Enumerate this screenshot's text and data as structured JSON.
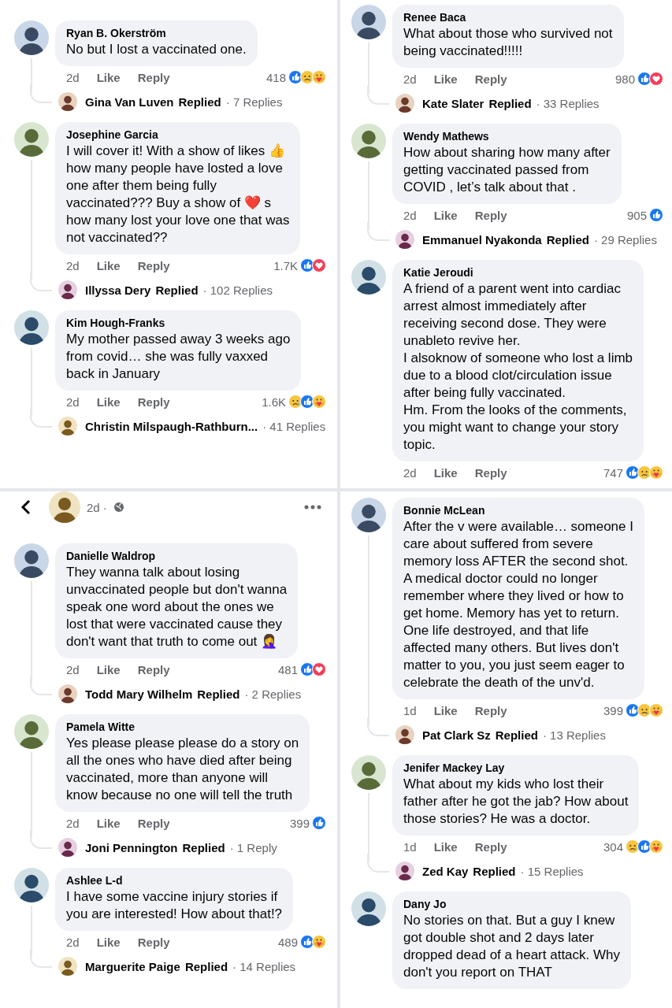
{
  "rows": [
    {
      "panels": [
        {
          "comments": [
            {
              "name": "Ryan B. Okerström",
              "text": "No but I lost a vaccinated one.",
              "time": "2d",
              "like": "Like",
              "reply": "Reply",
              "count": "418",
              "reactions": [
                {
                  "kind": "like"
                },
                {
                  "kind": "sad"
                },
                {
                  "kind": "care"
                }
              ],
              "thread": {
                "name": "Gina Van Luven",
                "label": "Replied",
                "replies": "· 7 Replies"
              }
            },
            {
              "name": "Josephine Garcia",
              "text": "I will cover it! With a show of likes 👍\nhow many people  have losted a love\none after them being fully\nvaccinated??? Buy a show  of  ❤️ s\nhow many lost your love one that was\nnot vaccinated??",
              "time": "2d",
              "like": "Like",
              "reply": "Reply",
              "count": "1.7K",
              "reactions": [
                {
                  "kind": "like"
                },
                {
                  "kind": "love"
                }
              ],
              "thread": {
                "name": "Illyssa Dery",
                "label": "Replied",
                "replies": "· 102 Replies"
              }
            },
            {
              "name": "Kim Hough-Franks",
              "text": "My mother passed away 3 weeks ago\nfrom covid… she was fully vaxxed\nback in January",
              "time": "2d",
              "like": "Like",
              "reply": "Reply",
              "count": "1.6K",
              "reactions": [
                {
                  "kind": "sad"
                },
                {
                  "kind": "like"
                },
                {
                  "kind": "care"
                }
              ],
              "thread": {
                "name": "Christin Milspaugh-Rathburn...",
                "replies": "· 41 Replies"
              }
            }
          ]
        },
        {
          "comments": [
            {
              "name": "Renee Baca",
              "text": "What about those who survived not\nbeing vaccinated!!!!!",
              "time": "2d",
              "like": "Like",
              "reply": "Reply",
              "count": "980",
              "reactions": [
                {
                  "kind": "like"
                },
                {
                  "kind": "love"
                }
              ],
              "thread": {
                "name": "Kate Slater",
                "label": "Replied",
                "replies": "· 33 Replies"
              }
            },
            {
              "name": "Wendy Mathews",
              "text": "How about sharing how many after\ngetting vaccinated passed from\nCOVID , let’s talk about that .",
              "time": "2d",
              "like": "Like",
              "reply": "Reply",
              "count": "905",
              "reactions": [
                {
                  "kind": "like"
                }
              ],
              "thread": {
                "name": "Emmanuel Nyakonda",
                "label": "Replied",
                "replies": "· 29 Replies"
              }
            },
            {
              "name": "Katie Jeroudi",
              "text": "A friend of a parent went into cardiac\narrest almost immediately after\nreceiving second dose. They were\nunableto revive her.\nI alsoknow of someone who lost a limb\ndue to a blood clot/circulation issue\nafter being fully vaccinated.\nHm. From the looks of the comments,\nyou might want to change your story\ntopic.",
              "time": "2d",
              "like": "Like",
              "reply": "Reply",
              "count": "747",
              "reactions": [
                {
                  "kind": "like"
                },
                {
                  "kind": "sad"
                },
                {
                  "kind": "care"
                }
              ]
            }
          ]
        }
      ]
    },
    {
      "panels": [
        {
          "header": {
            "time": "2d ·"
          },
          "comments": [
            {
              "name": "Danielle Waldrop",
              "text": "They wanna talk about losing\nunvaccinated people but don't wanna\nspeak one word about the ones we\nlost that were vaccinated cause they\ndon't want that truth to come out 🤦‍♀️",
              "time": "2d",
              "like": "Like",
              "reply": "Reply",
              "count": "481",
              "reactions": [
                {
                  "kind": "like"
                },
                {
                  "kind": "love"
                }
              ],
              "thread": {
                "name": "Todd Mary Wilhelm",
                "label": "Replied",
                "replies": "· 2 Replies"
              }
            },
            {
              "name": "Pamela Witte",
              "text": "Yes please please please do a story on\nall the ones who have died after being\nvaccinated, more than anyone will\nknow because no one will tell the truth",
              "time": "2d",
              "like": "Like",
              "reply": "Reply",
              "count": "399",
              "reactions": [
                {
                  "kind": "like"
                }
              ],
              "thread": {
                "name": "Joni Pennington",
                "label": "Replied",
                "replies": "· 1 Reply"
              }
            },
            {
              "name": "Ashlee L-d",
              "text": "I have some vaccine injury stories if\nyou are interested! How about that!?",
              "time": "2d",
              "like": "Like",
              "reply": "Reply",
              "count": "489",
              "reactions": [
                {
                  "kind": "like"
                },
                {
                  "kind": "care"
                }
              ],
              "thread": {
                "name": "Marguerite Paige",
                "label": "Replied",
                "replies": "· 14 Replies"
              }
            }
          ]
        },
        {
          "comments": [
            {
              "name": "Bonnie McLean",
              "text": "After the v were available…  someone I\ncare about suffered from severe\nmemory loss AFTER the second shot.\nA medical doctor could no longer\nremember where they lived or how to\nget home.  Memory has yet to return.\nOne life destroyed, and that life\naffected many others.  But lives don't\nmatter to you, you just seem eager to\ncelebrate the death of the unv'd.",
              "time": "1d",
              "like": "Like",
              "reply": "Reply",
              "count": "399",
              "reactions": [
                {
                  "kind": "like"
                },
                {
                  "kind": "sad"
                },
                {
                  "kind": "care"
                }
              ],
              "thread": {
                "name": "Pat Clark Sz",
                "label": "Replied",
                "replies": "· 13 Replies"
              }
            },
            {
              "name": "Jenifer Mackey Lay",
              "text": "What about my kids who lost their\nfather after he got the jab? How about\nthose stories? He was a doctor.",
              "time": "1d",
              "like": "Like",
              "reply": "Reply",
              "count": "304",
              "reactions": [
                {
                  "kind": "sad"
                },
                {
                  "kind": "like"
                },
                {
                  "kind": "care"
                }
              ],
              "thread": {
                "name": "Zed Kay",
                "label": "Replied",
                "replies": "· 15 Replies"
              }
            },
            {
              "name": "Dany Jo",
              "text": "No stories on that. But a guy I knew\ngot double shot and 2 days later\ndropped dead of a heart attack. Why\ndon't you report on THAT"
            }
          ]
        }
      ]
    }
  ]
}
